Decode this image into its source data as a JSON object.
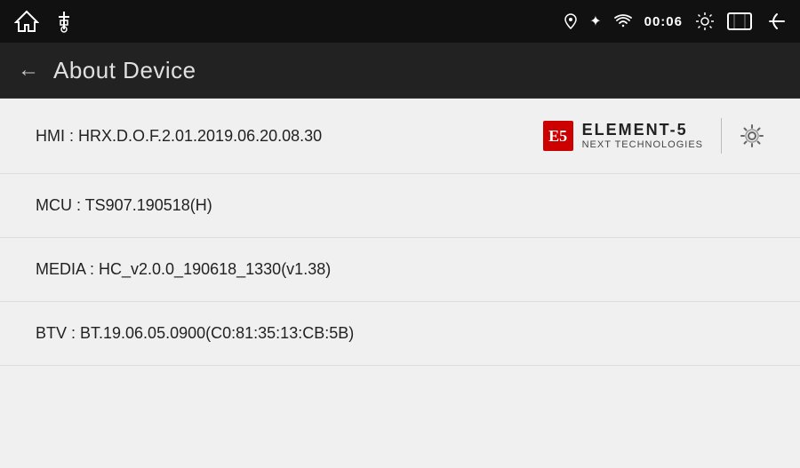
{
  "statusBar": {
    "time": "00:06",
    "icons": [
      "location",
      "bluetooth",
      "wifi"
    ]
  },
  "titleBar": {
    "back_label": "←",
    "title": "About Device"
  },
  "brand": {
    "badge": "E5",
    "name": "ELEMENT-5",
    "subtitle": "NEXT TECHNOLOGIES"
  },
  "infoRows": [
    {
      "id": "hmi",
      "label": "HMI : HRX.D.O.F.2.01.2019.06.20.08.30",
      "showLogo": true
    },
    {
      "id": "mcu",
      "label": "MCU : TS907.190518(H)",
      "showLogo": false
    },
    {
      "id": "media",
      "label": "MEDIA : HC_v2.0.0_190618_1330(v1.38)",
      "showLogo": false
    },
    {
      "id": "btv",
      "label": "BTV : BT.19.06.05.0900(C0:81:35:13:CB:5B)",
      "showLogo": false
    }
  ]
}
